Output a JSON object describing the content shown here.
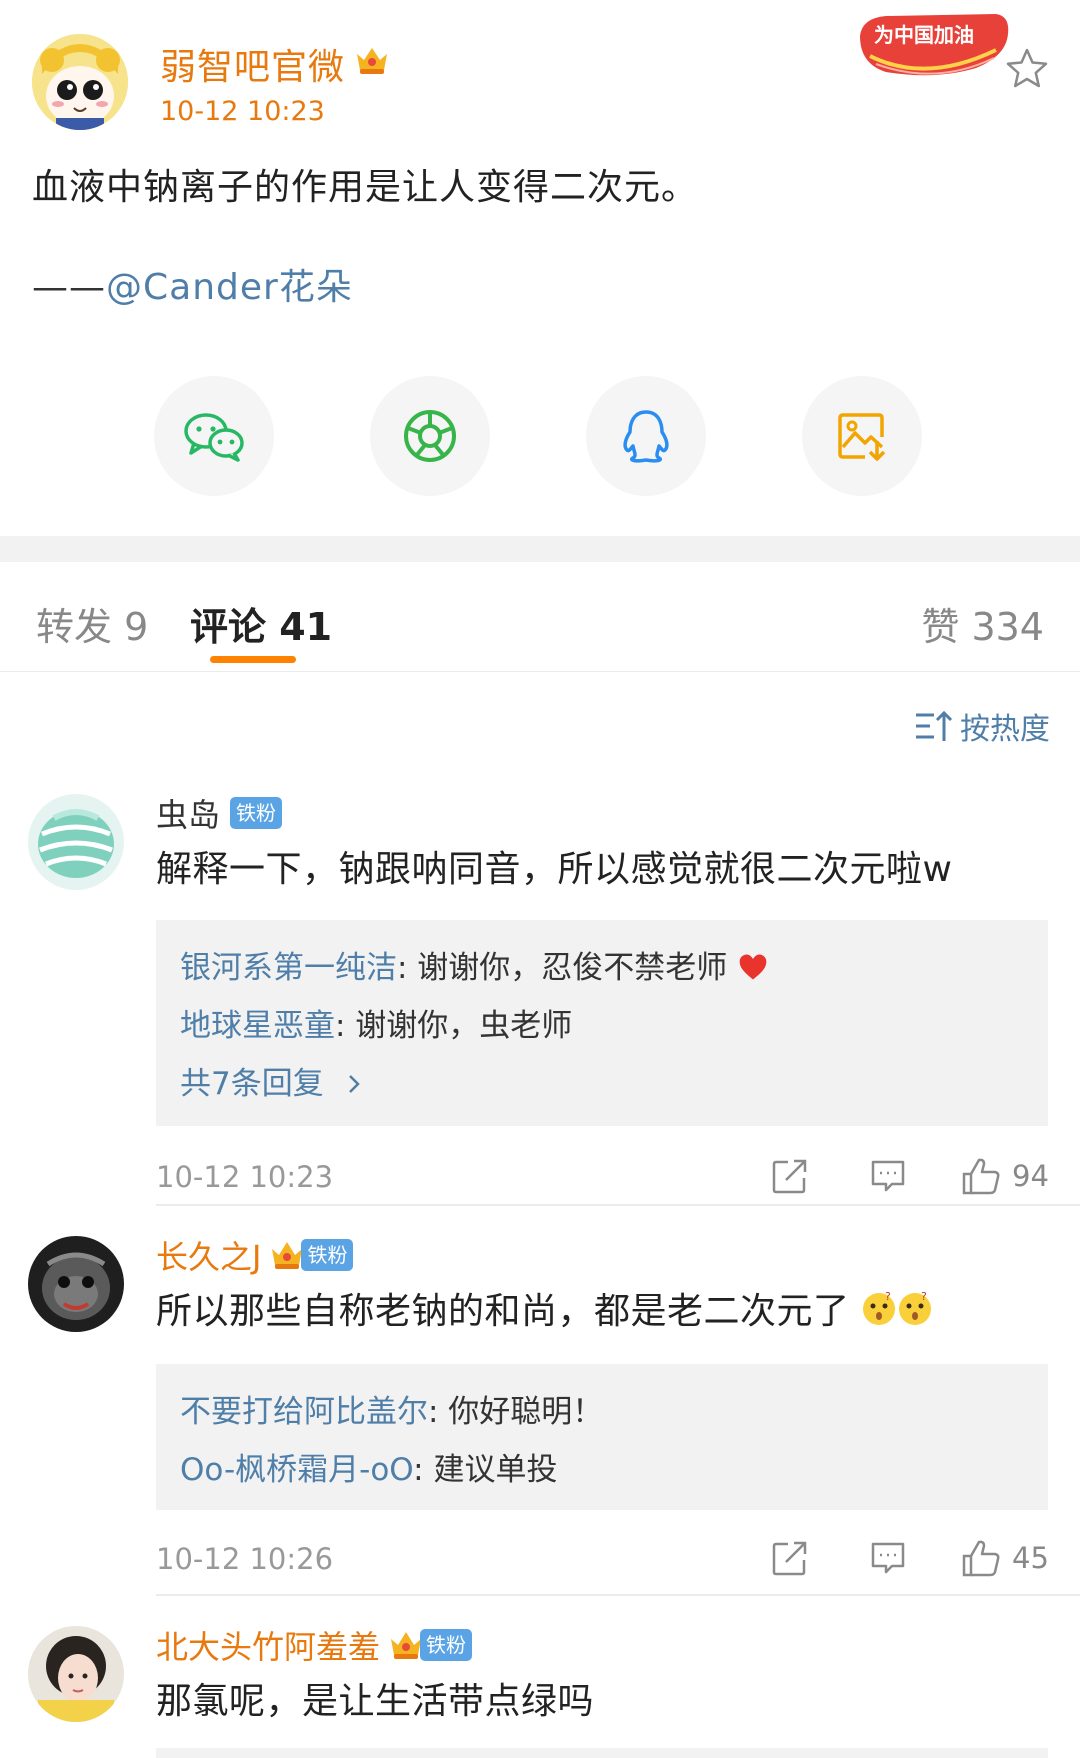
{
  "post": {
    "author": "弱智吧官微",
    "time": "10-12 10:23",
    "promo_badge": "为中国加油",
    "text": "血液中钠离子的作用是让人变得二次元。",
    "credit_dash": "——",
    "credit_user": "@Cander花朵"
  },
  "share": {
    "items": [
      "wechat-icon",
      "moments-icon",
      "qq-icon",
      "save-image-icon"
    ]
  },
  "tabs": {
    "repost": "转发 9",
    "comments": "评论 41",
    "likes": "赞 334"
  },
  "sort": {
    "label": "按热度"
  },
  "comments": [
    {
      "user": "虫岛",
      "badge": "铁粉",
      "text": "解释一下，钠跟呐同音，所以感觉就很二次元啦w",
      "replies": [
        {
          "user": "银河系第一纯洁",
          "text": ": 谢谢你，忍俊不禁老师"
        },
        {
          "user": "地球星恶童",
          "text": ": 谢谢你，虫老师"
        }
      ],
      "more": "共7条回复",
      "time": "10-12 10:23",
      "likes": "94"
    },
    {
      "user": "长久之J",
      "badge": "铁粉",
      "text": "所以那些自称老钠的和尚，都是老二次元了",
      "replies": [
        {
          "user": "不要打给阿比盖尔",
          "text": ": 你好聪明！"
        },
        {
          "user": "Oo-枫桥霜月-oO",
          "text": ": 建议单投"
        }
      ],
      "time": "10-12 10:26",
      "likes": "45"
    },
    {
      "user": "北大头竹阿羞羞",
      "badge": "铁粉",
      "text": "那氯呢，是让生活带点绿吗"
    }
  ],
  "colors": {
    "accent": "#ff8200",
    "name_orange": "#e8790f",
    "link_blue": "#4f7ea8",
    "badge_blue": "#5aa4e6"
  }
}
